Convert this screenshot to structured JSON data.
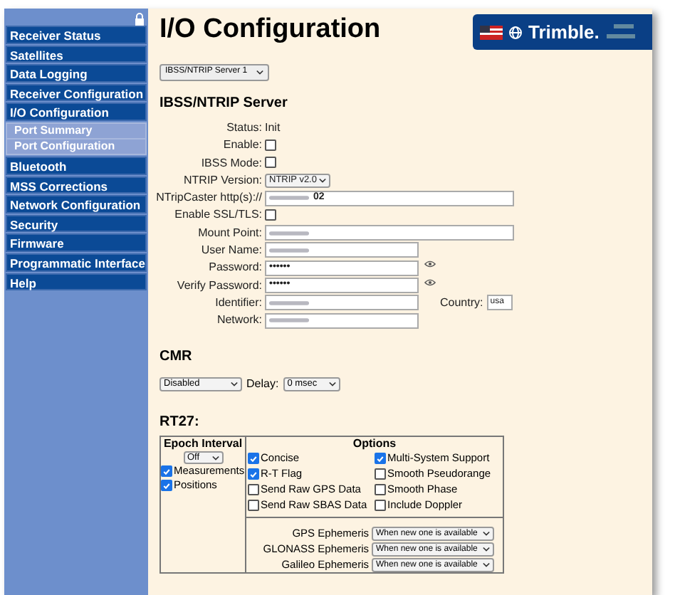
{
  "sidebar": {
    "items": [
      {
        "label": "Receiver Status"
      },
      {
        "label": "Satellites"
      },
      {
        "label": "Data Logging"
      },
      {
        "label": "Receiver Configuration"
      },
      {
        "label": "I/O Configuration",
        "children": [
          {
            "label": "Port Summary"
          },
          {
            "label": "Port Configuration"
          }
        ]
      },
      {
        "label": "Bluetooth"
      },
      {
        "label": "MSS Corrections"
      },
      {
        "label": "Network Configuration"
      },
      {
        "label": "Security"
      },
      {
        "label": "Firmware"
      },
      {
        "label": "Programmatic Interface"
      },
      {
        "label": "Help"
      }
    ]
  },
  "header": {
    "title": "I/O Configuration",
    "brand": "Trimble."
  },
  "port_select": "IBSS/NTRIP Server 1",
  "server": {
    "heading": "IBSS/NTRIP Server",
    "rows": [
      {
        "kind": "text",
        "label": "Status:",
        "value": "Init"
      },
      {
        "kind": "checkbox",
        "label": "Enable:",
        "checked": false
      },
      {
        "kind": "checkbox",
        "label": "IBSS Mode:",
        "checked": false
      },
      {
        "kind": "select",
        "label": "NTRIP Version:",
        "value": "NTRIP v2.0"
      },
      {
        "kind": "wide_input",
        "label": "NTripCaster http(s)://",
        "value": "02",
        "blurred": true
      },
      {
        "kind": "checkbox",
        "label": "Enable SSL/TLS:",
        "checked": false
      },
      {
        "kind": "wide_input",
        "label": "Mount Point:",
        "blurred": true
      },
      {
        "kind": "input",
        "label": "User Name:",
        "blurred": true
      },
      {
        "kind": "password",
        "label": "Password:",
        "value": "••••••"
      },
      {
        "kind": "password",
        "label": "Verify Password:",
        "value": "••••••"
      },
      {
        "kind": "input",
        "label": "Identifier:",
        "blurred": true,
        "country": {
          "label": "Country:",
          "value": "usa"
        }
      },
      {
        "kind": "input",
        "label": "Network:",
        "blurred": true
      }
    ]
  },
  "cmr": {
    "heading": "CMR",
    "mode": "Disabled",
    "delay_label": "Delay:",
    "delay": "0 msec"
  },
  "rt27": {
    "heading": "RT27:",
    "epoch": {
      "heading": "Epoch Interval",
      "value": "Off",
      "checks": [
        {
          "label": "Measurements",
          "checked": true
        },
        {
          "label": "Positions",
          "checked": true
        }
      ]
    },
    "options": {
      "heading": "Options",
      "checks": [
        {
          "label": "Concise",
          "checked": true
        },
        {
          "label": "Multi-System Support",
          "checked": true
        },
        {
          "label": "R-T Flag",
          "checked": true
        },
        {
          "label": "Smooth Pseudorange",
          "checked": false
        },
        {
          "label": "Send Raw GPS Data",
          "checked": false
        },
        {
          "label": "Smooth Phase",
          "checked": false
        },
        {
          "label": "Send Raw SBAS Data",
          "checked": false
        },
        {
          "label": "Include Doppler",
          "checked": false
        }
      ]
    },
    "ephemeris": [
      {
        "label": "GPS Ephemeris",
        "value": "When new one is available"
      },
      {
        "label": "GLONASS Ephemeris",
        "value": "When new one is available"
      },
      {
        "label": "Galileo Ephemeris",
        "value": "When new one is available"
      }
    ]
  }
}
